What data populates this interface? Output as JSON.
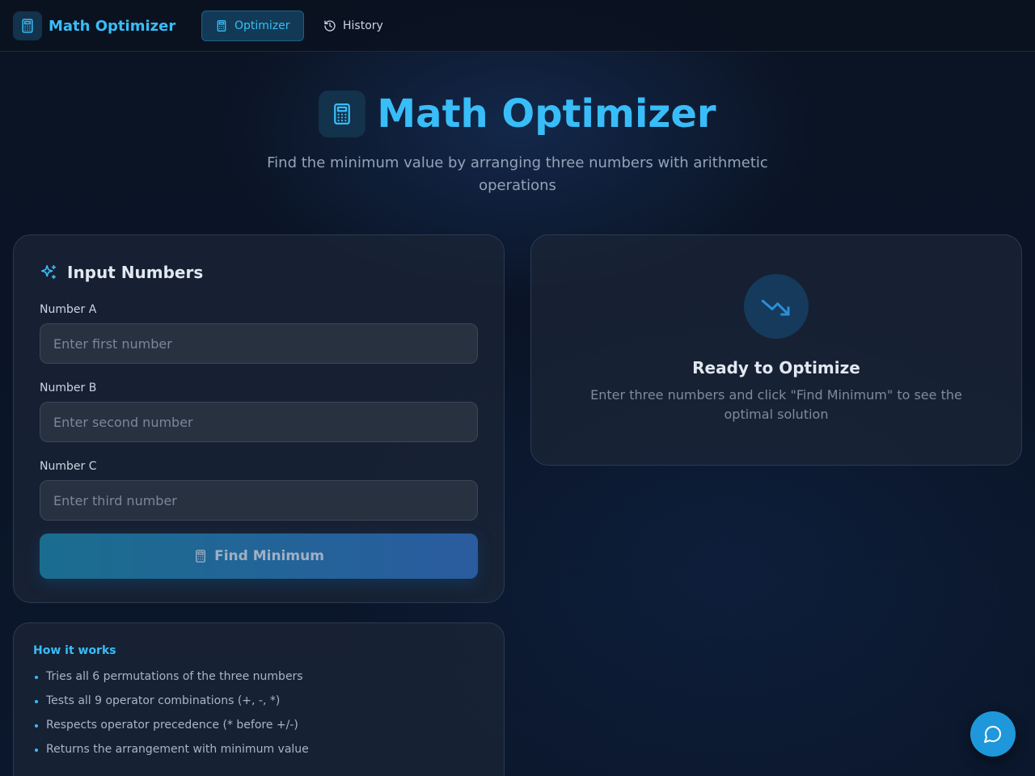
{
  "nav": {
    "brand_title": "Math Optimizer",
    "tabs": [
      {
        "label": "Optimizer",
        "icon": "calculator-icon",
        "active": true
      },
      {
        "label": "History",
        "icon": "history-icon",
        "active": false
      }
    ]
  },
  "hero": {
    "title": "Math Optimizer",
    "subtitle": "Find the minimum value by arranging three numbers with arithmetic operations",
    "icon": "calculator-icon"
  },
  "input_card": {
    "title": "Input Numbers",
    "icon": "sparkles-icon",
    "fields": [
      {
        "label": "Number A",
        "value": "",
        "placeholder": "Enter first number"
      },
      {
        "label": "Number B",
        "value": "",
        "placeholder": "Enter second number"
      },
      {
        "label": "Number C",
        "value": "",
        "placeholder": "Enter third number"
      }
    ],
    "submit_label": "Find Minimum",
    "submit_icon": "calculator-icon"
  },
  "result_card": {
    "icon": "trending-down-icon",
    "title": "Ready to Optimize",
    "subtitle": "Enter three numbers and click \"Find Minimum\" to see the optimal solution"
  },
  "how_it_works": {
    "title": "How it works",
    "items": [
      "Tries all 6 permutations of the three numbers",
      "Tests all 9 operator combinations (+, -, *)",
      "Respects operator precedence (* before +/-)",
      "Returns the arrangement with minimum value"
    ]
  },
  "chat_button": {
    "icon": "chat-bubble-icon"
  },
  "colors": {
    "accent": "#38bdf8",
    "background": "#0b1424",
    "card": "#1c2638",
    "button_gradient_start": "#1a6d8f",
    "button_gradient_end": "#2a5c9f",
    "fab": "#1e98db"
  }
}
